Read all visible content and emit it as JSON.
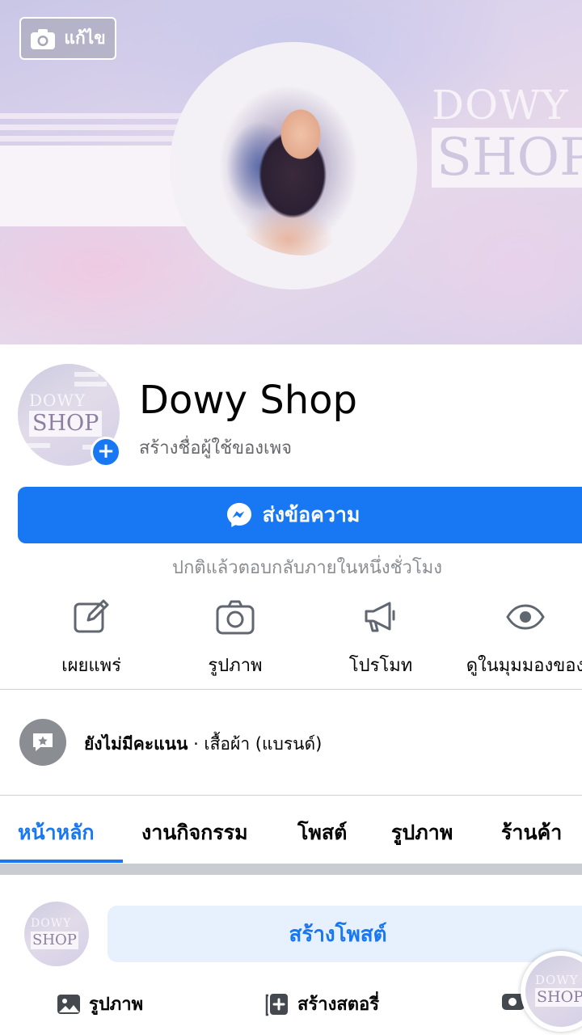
{
  "cover": {
    "edit_label": "แก้ไข",
    "brand_line1": "DOWY",
    "brand_line2": "SHOP"
  },
  "profile": {
    "name": "Dowy Shop",
    "username_prompt": "สร้างชื่อผู้ใช้ของเพจ",
    "logo_line1": "DOWY",
    "logo_line2": "SHOP"
  },
  "message_button": {
    "label": "ส่งข้อความ"
  },
  "reply_note": "ปกติแล้วตอบกลับภายในหนึ่งชั่วโมง",
  "actions": [
    {
      "label": "เผยแพร่",
      "icon": "edit-icon"
    },
    {
      "label": "รูปภาพ",
      "icon": "camera-icon"
    },
    {
      "label": "โปรโมท",
      "icon": "megaphone-icon"
    },
    {
      "label": "ดูในมุมมองของ",
      "icon": "eye-icon"
    }
  ],
  "rating": {
    "status": "ยังไม่มีคะแนน",
    "separator": " · ",
    "category": "เสื้อผ้า (แบรนด์)"
  },
  "tabs": [
    {
      "label": "หน้าหลัก",
      "active": true
    },
    {
      "label": "งานกิจกรรม",
      "active": false
    },
    {
      "label": "โพสต์",
      "active": false
    },
    {
      "label": "รูปภาพ",
      "active": false
    },
    {
      "label": "ร้านค้า",
      "active": false
    }
  ],
  "composer": {
    "create_post_label": "สร้างโพสต์",
    "photo_label": "รูปภาพ",
    "story_label": "สร้างสตอรี่"
  },
  "colors": {
    "accent": "#1877f2",
    "secondary_text": "#65676b"
  }
}
